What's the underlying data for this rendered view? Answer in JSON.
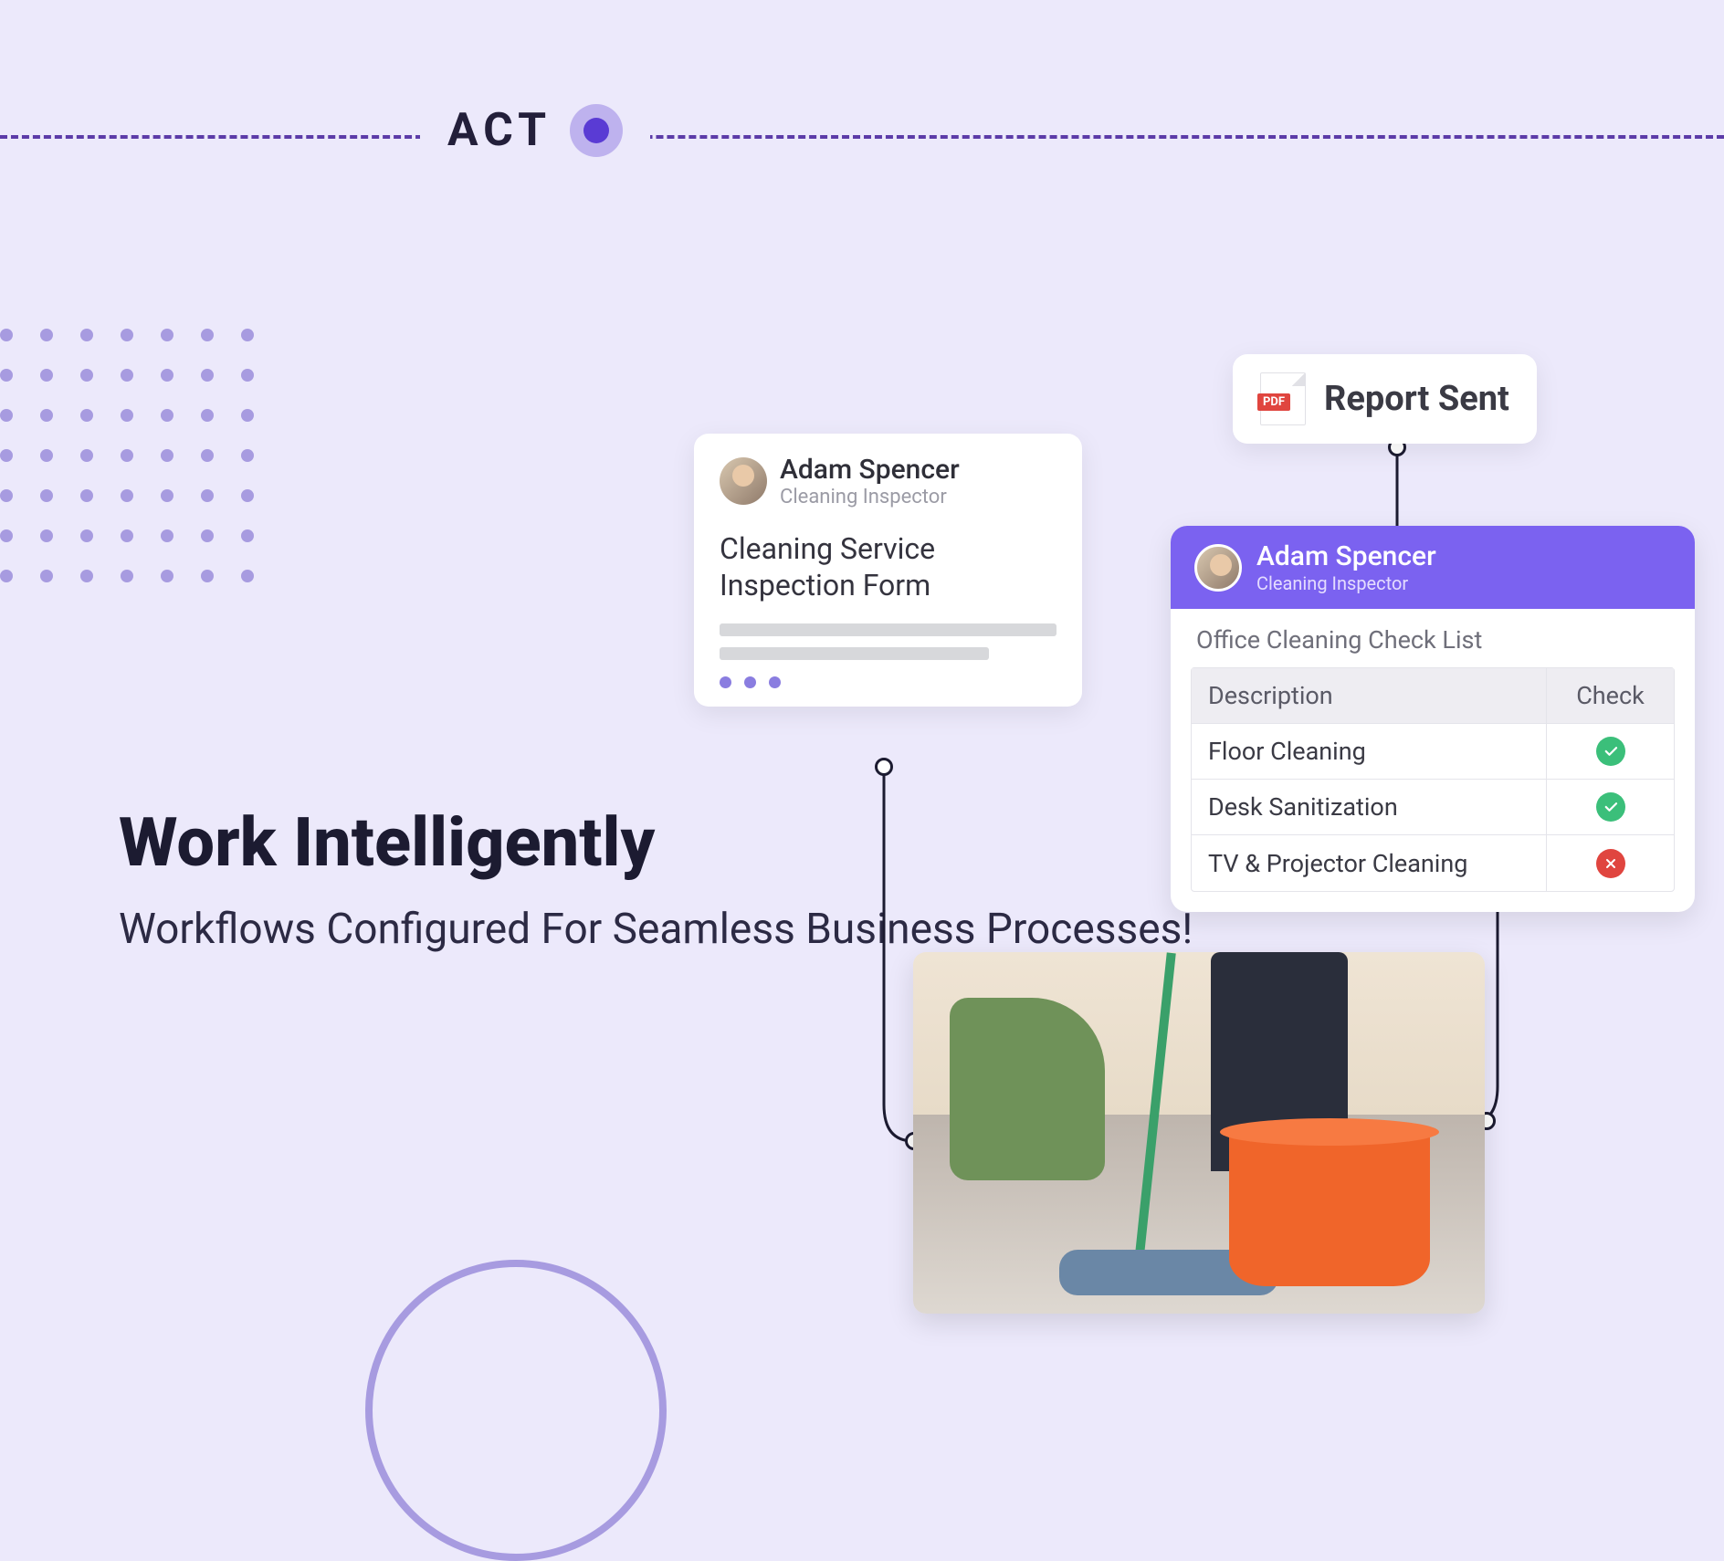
{
  "top": {
    "label": "ACT"
  },
  "headline": {
    "title": "Work Intelligently",
    "subtitle": "Workflows Configured For Seamless Business Processes!"
  },
  "form_card": {
    "user_name": "Adam Spencer",
    "user_role": "Cleaning Inspector",
    "title": "Cleaning Service Inspection Form"
  },
  "report_card": {
    "text": "Report Sent",
    "file_type": "PDF"
  },
  "checklist_card": {
    "user_name": "Adam Spencer",
    "user_role": "Cleaning Inspector",
    "title": "Office Cleaning Check List",
    "header_desc": "Description",
    "header_check": "Check",
    "rows": [
      {
        "desc": "Floor Cleaning",
        "status": "ok"
      },
      {
        "desc": "Desk Sanitization",
        "status": "ok"
      },
      {
        "desc": "TV & Projector Cleaning",
        "status": "no"
      }
    ]
  },
  "image_card": {
    "alt": "Person mopping office floor with orange bucket"
  }
}
